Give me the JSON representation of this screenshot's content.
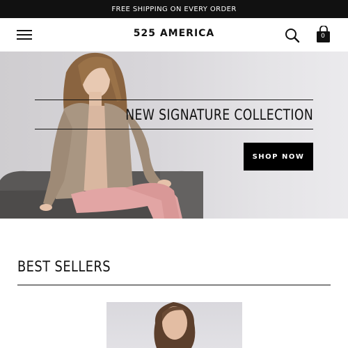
{
  "promo": {
    "text": "FREE SHIPPING ON EVERY ORDER"
  },
  "header": {
    "logo": "525 AMERICA",
    "menu_icon": "hamburger-menu-icon",
    "search_icon": "search-icon",
    "cart_icon": "shopping-bag-icon",
    "cart_count": "0"
  },
  "hero": {
    "title": "NEW SIGNATURE COLLECTION",
    "cta": "SHOP NOW",
    "image": "woman in tan cardigan and pink pants sitting on gray sofa"
  },
  "best_sellers": {
    "title": "BEST SELLERS",
    "product_image": "woman with brown hair product photo"
  },
  "colors": {
    "promo_bg": "#111111",
    "text": "#111111",
    "button_bg": "#000000",
    "hero_bg": "#d8d6da"
  }
}
